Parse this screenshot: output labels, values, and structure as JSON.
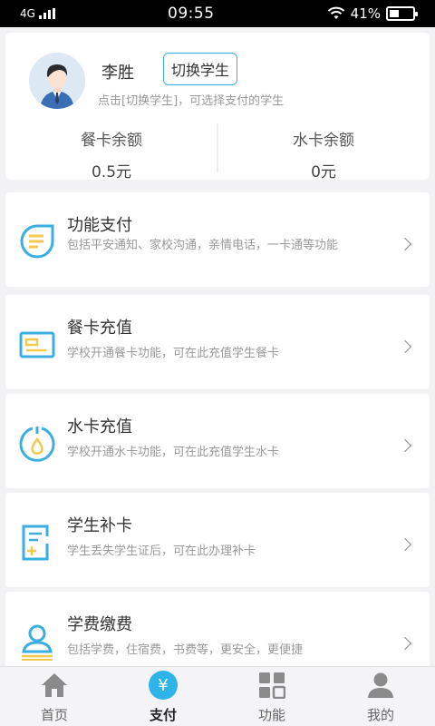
{
  "status_bar": {
    "network": "4G",
    "time": "09:55",
    "battery": "41%",
    "battery_level": 0.41
  },
  "profile": {
    "name": "李胜",
    "switch_label": "切换学生",
    "hint": "点击[切换学生]，可选择支付的学生",
    "meal_balance_label": "餐卡余额",
    "meal_balance_value": "0.5元",
    "water_balance_label": "水卡余额",
    "water_balance_value": "0元"
  },
  "menu": [
    {
      "icon": "document-lines-icon",
      "title": "功能支付",
      "desc": "包括平安通知、家校沟通，亲情电话，一卡通等功能"
    },
    {
      "icon": "card-icon",
      "title": "餐卡充值",
      "desc": "学校开通餐卡功能，可在此充值学生餐卡"
    },
    {
      "icon": "water-drop-icon",
      "title": "水卡充值",
      "desc": "学校开通水卡功能，可在此充值学生水卡"
    },
    {
      "icon": "replace-card-icon",
      "title": "学生补卡",
      "desc": "学生丢失学生证后，可在此办理补卡"
    },
    {
      "icon": "tuition-user-icon",
      "title": "学费缴费",
      "desc": "包括学费，住宿费，书费等，更安全，更便捷"
    }
  ],
  "bottom_nav": [
    {
      "label": "首页",
      "icon": "home-icon"
    },
    {
      "label": "支付",
      "icon": "yuan-icon",
      "symbol": "¥"
    },
    {
      "label": "功能",
      "icon": "grid-icon"
    },
    {
      "label": "我的",
      "icon": "user-icon"
    }
  ],
  "colors": {
    "accent": "#2db3e8",
    "icon_blue": "#3aaee0",
    "icon_yellow": "#f2c94c"
  }
}
